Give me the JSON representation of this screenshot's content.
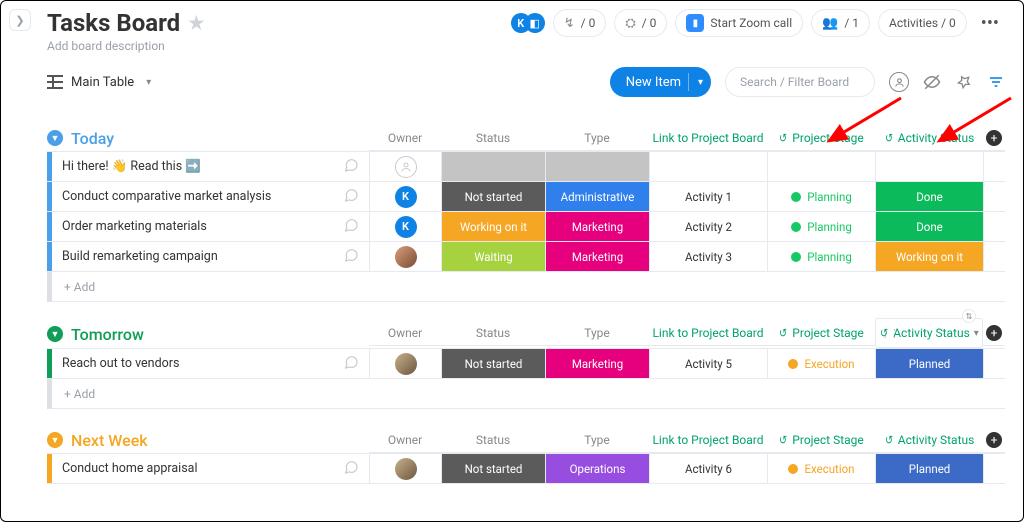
{
  "header": {
    "title": "Tasks Board",
    "subtitle": "Add board description",
    "avatarInitial": "K",
    "integrations": "0",
    "automations": "0",
    "zoomLabel": "Start Zoom call",
    "membersCount": "1",
    "activitiesLabel": "Activities / 0"
  },
  "toolbar": {
    "mainTable": "Main Table",
    "newItem": "New Item",
    "searchPlaceholder": "Search / Filter Board"
  },
  "columns": {
    "owner": "Owner",
    "status": "Status",
    "type": "Type",
    "link": "Link to Project Board",
    "stage": "Project Stage",
    "activity": "Activity Status"
  },
  "groups": [
    {
      "name": "Today",
      "color": "#49a0e8",
      "rows": [
        {
          "task": "Hi there! 👋 Read this ➡️",
          "owner": {
            "kind": "empty"
          },
          "status": null,
          "type": null,
          "link": "",
          "stage": null,
          "activity": null
        },
        {
          "task": "Conduct comparative market analysis",
          "owner": {
            "kind": "k"
          },
          "status": {
            "label": "Not started",
            "bg": "#5b5b5b"
          },
          "type": {
            "label": "Administrative",
            "bg": "#2f80ed"
          },
          "link": "Activity 1",
          "stage": {
            "label": "Planning",
            "dot": "#17c964",
            "text": "#17c964"
          },
          "activity": {
            "label": "Done",
            "bg": "#0bba5b"
          }
        },
        {
          "task": "Order marketing materials",
          "owner": {
            "kind": "k"
          },
          "status": {
            "label": "Working on it",
            "bg": "#f5a623"
          },
          "type": {
            "label": "Marketing",
            "bg": "#e6007e"
          },
          "link": "Activity 2",
          "stage": {
            "label": "Planning",
            "dot": "#17c964",
            "text": "#17c964"
          },
          "activity": {
            "label": "Done",
            "bg": "#0bba5b"
          }
        },
        {
          "task": "Build remarketing campaign",
          "owner": {
            "kind": "photo"
          },
          "status": {
            "label": "Waiting",
            "bg": "#a5d23e"
          },
          "type": {
            "label": "Marketing",
            "bg": "#e6007e"
          },
          "link": "Activity 3",
          "stage": {
            "label": "Planning",
            "dot": "#17c964",
            "text": "#17c964"
          },
          "activity": {
            "label": "Working on it",
            "bg": "#f5a623"
          }
        }
      ],
      "addLabel": "+ Add"
    },
    {
      "name": "Tomorrow",
      "color": "#0f9d58",
      "activityHeaderActive": true,
      "rows": [
        {
          "task": "Reach out to vendors",
          "owner": {
            "kind": "photo2"
          },
          "status": {
            "label": "Not started",
            "bg": "#5b5b5b"
          },
          "type": {
            "label": "Marketing",
            "bg": "#e6007e"
          },
          "link": "Activity 5",
          "stage": {
            "label": "Execution",
            "dot": "#f5a623",
            "text": "#f5a623"
          },
          "activity": {
            "label": "Planned",
            "bg": "#3b6ac7"
          }
        }
      ],
      "addLabel": "+ Add"
    },
    {
      "name": "Next Week",
      "color": "#f5a623",
      "rows": [
        {
          "task": "Conduct home appraisal",
          "owner": {
            "kind": "photo2"
          },
          "status": {
            "label": "Not started",
            "bg": "#5b5b5b"
          },
          "type": {
            "label": "Operations",
            "bg": "#974ee0"
          },
          "link": "Activity 6",
          "stage": {
            "label": "Execution",
            "dot": "#f5a623",
            "text": "#f5a623"
          },
          "activity": {
            "label": "Planned",
            "bg": "#3b6ac7"
          }
        }
      ]
    }
  ]
}
